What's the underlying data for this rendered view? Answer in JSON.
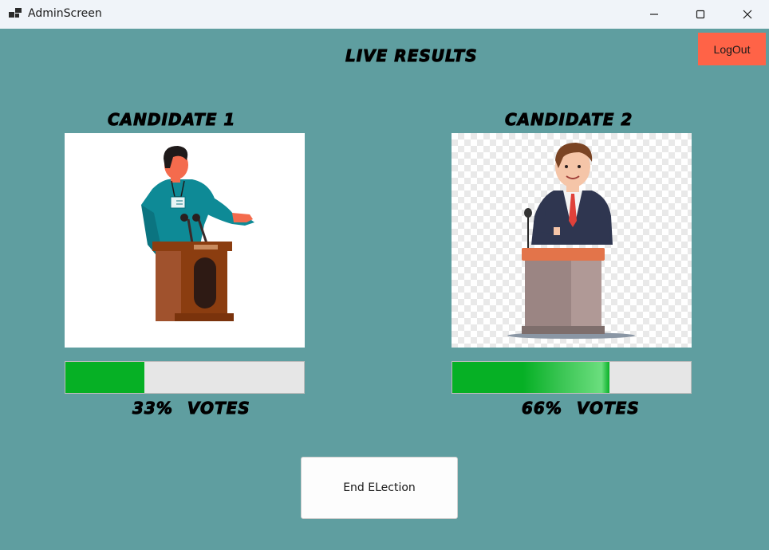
{
  "window": {
    "title": "AdminScreen",
    "icon": "window-app-icon"
  },
  "header": {
    "title": "LIVE RESULTS",
    "logout_label": "LogOut"
  },
  "candidates": [
    {
      "name": "CANDIDATE 1",
      "percent_label": "33%",
      "votes_label": "VOTES",
      "progress": 0.33,
      "image": "speaker-at-podium-illustration"
    },
    {
      "name": "CANDIDATE 2",
      "percent_label": "66%",
      "votes_label": "VOTES",
      "progress": 0.66,
      "image": "businessman-at-podium-illustration"
    }
  ],
  "actions": {
    "end_election_label": "End ELection"
  },
  "colors": {
    "background": "#5f9ea0",
    "logout": "#ff6347",
    "progress_fill": "#06b025",
    "progress_track": "#e6e6e6"
  }
}
